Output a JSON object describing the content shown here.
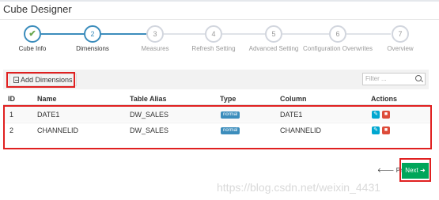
{
  "app": {
    "title": "Cube Designer"
  },
  "wizard": {
    "steps": [
      {
        "number": "",
        "label": "Cube Info",
        "state": "done"
      },
      {
        "number": "2",
        "label": "Dimensions",
        "state": "active"
      },
      {
        "number": "3",
        "label": "Measures",
        "state": "pending"
      },
      {
        "number": "4",
        "label": "Refresh Setting",
        "state": "pending"
      },
      {
        "number": "5",
        "label": "Advanced Setting",
        "state": "pending"
      },
      {
        "number": "6",
        "label": "Configuration Overwrites",
        "state": "pending"
      },
      {
        "number": "7",
        "label": "Overview",
        "state": "pending"
      }
    ]
  },
  "toolbar": {
    "add_label": "Add Dimensions",
    "filter_placeholder": "Filter ..."
  },
  "table": {
    "columns": [
      "ID",
      "Name",
      "Table Alias",
      "Type",
      "Column",
      "Actions"
    ],
    "rows": [
      {
        "id": "1",
        "name": "DATE1",
        "alias": "DW_SALES",
        "type": "normal",
        "column": "DATE1"
      },
      {
        "id": "2",
        "name": "CHANNELID",
        "alias": "DW_SALES",
        "type": "normal",
        "column": "CHANNELID"
      }
    ]
  },
  "nav": {
    "prev_label": "Prev",
    "next_label": "Next"
  },
  "watermark": "https://blog.csdn.net/weixin_4431",
  "colors": {
    "accent": "#3c8dbc",
    "success": "#00a65a",
    "danger": "#dd4b39",
    "highlight": "#e02020"
  }
}
